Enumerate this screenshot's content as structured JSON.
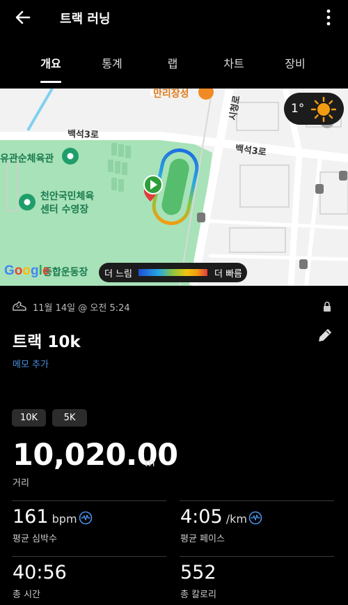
{
  "header": {
    "title": "트랙 러닝"
  },
  "tabs": [
    {
      "label": "개요",
      "active": true
    },
    {
      "label": "통계",
      "active": false
    },
    {
      "label": "랩",
      "active": false
    },
    {
      "label": "차트",
      "active": false
    },
    {
      "label": "장비",
      "active": false
    }
  ],
  "map": {
    "labels": {
      "road1": "백석3로",
      "road2": "백석3로",
      "road3": "시청로",
      "place1": "유관순체육관",
      "place2_line1": "천안국민체육",
      "place2_line2": "센터 수영장",
      "place3": "만리장성",
      "place4": "종합운동장"
    },
    "weather": {
      "temperature": "1°",
      "icon": "sun-icon"
    },
    "google_logo": "Google",
    "pace_legend": {
      "slow": "더 느림",
      "fast": "더 빠름"
    }
  },
  "activity": {
    "icon": "running-shoe-icon",
    "date": "11월 14일 @ 오전 5:24",
    "title": "트랙 10k",
    "memo_link": "메모 추가",
    "chips": [
      "10K",
      "5K"
    ],
    "distance": {
      "value": "10,020.00",
      "unit": "m",
      "label": "거리"
    },
    "stats": [
      {
        "value": "161",
        "unit": "bpm",
        "label": "평균 심박수",
        "icon": "heart-rate-wave-icon"
      },
      {
        "value": "4:05",
        "unit": "/km",
        "label": "평균 페이스",
        "icon": "pace-wave-icon"
      },
      {
        "value": "40:56",
        "unit": "",
        "label": "총 시간"
      },
      {
        "value": "552",
        "unit": "",
        "label": "총 칼로리"
      }
    ]
  },
  "colors": {
    "accent_blue": "#4a90e2",
    "park_green": "#a8e2b8",
    "route_start": "#2e9e3a",
    "route_end": "#e23b3b"
  }
}
